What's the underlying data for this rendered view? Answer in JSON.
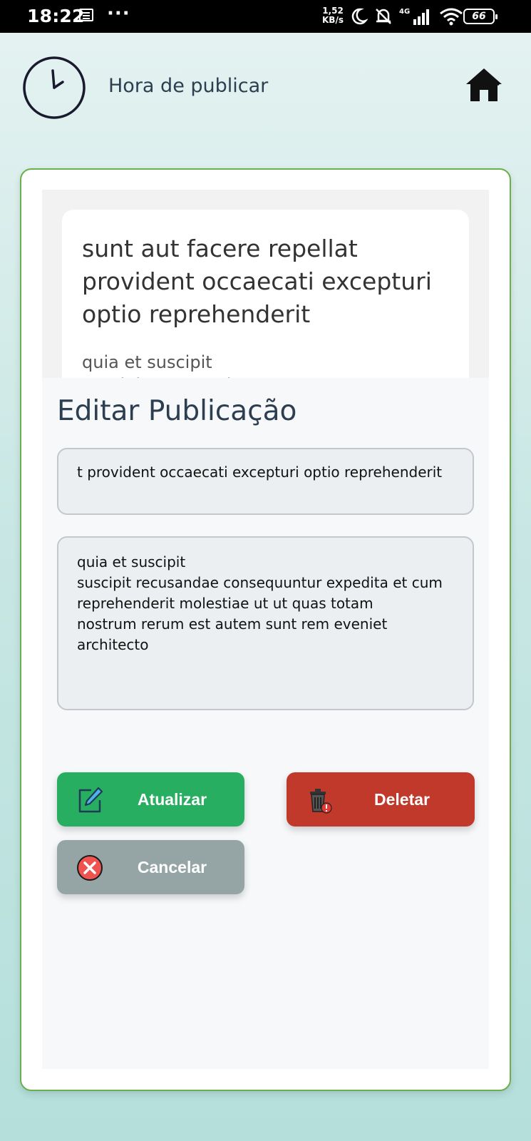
{
  "status_bar": {
    "time": "18:22",
    "more": "···",
    "net_speed_value": "1,52",
    "net_speed_unit": "KB/s",
    "network": "4G",
    "battery": "66"
  },
  "header": {
    "title": "Hora de publicar"
  },
  "post": {
    "title": "sunt aut facere repellat provident occaecati excepturi optio reprehenderit",
    "body": "quia et suscipit\nsuscipit recusandae consequuntur expedita"
  },
  "edit": {
    "heading": "Editar Publicação",
    "title_value": "t provident occaecati excepturi optio reprehenderit",
    "body_value": "quia et suscipit\nsuscipit recusandae consequuntur expedita et cum\nreprehenderit molestiae ut ut quas totam\nnostrum rerum est autem sunt rem eveniet\narchitecto"
  },
  "buttons": {
    "update": "Atualizar",
    "delete": "Deletar",
    "cancel": "Cancelar"
  },
  "colors": {
    "update": "#27ae60",
    "delete": "#c0392b",
    "cancel": "#95a5a6",
    "card_border": "#6ab04c"
  }
}
